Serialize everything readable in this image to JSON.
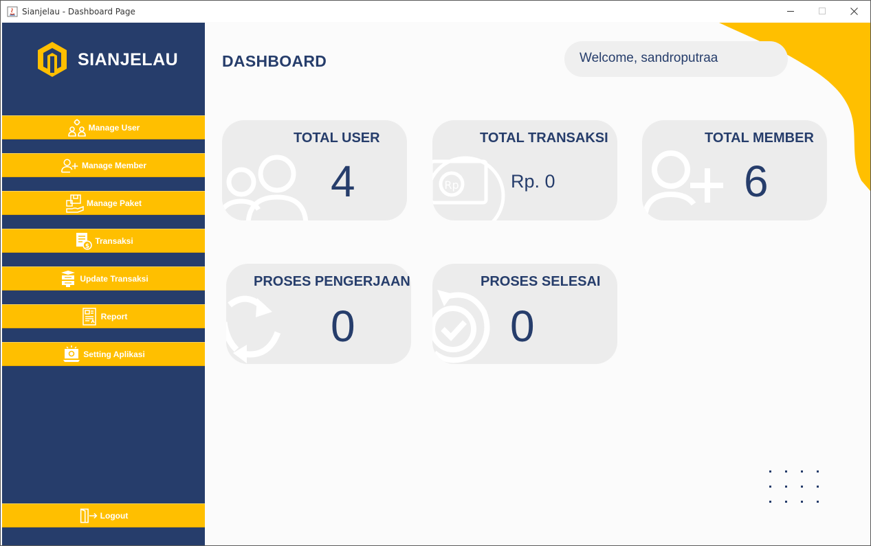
{
  "window": {
    "title": "Sianjelau - Dashboard Page",
    "controls": {
      "minimize": "minimize",
      "maximize": "maximize",
      "close": "close"
    }
  },
  "colors": {
    "navy": "#263d6b",
    "accent": "#ffbf00",
    "card": "#ececec",
    "background": "#fbfbfb"
  },
  "sidebar": {
    "brand": "SIANJELAU",
    "items": [
      {
        "label": "Manage User",
        "icon": "users-gear-icon"
      },
      {
        "label": "Manage Member",
        "icon": "add-user-icon"
      },
      {
        "label": "Manage Paket",
        "icon": "package-icon"
      },
      {
        "label": "Transaksi",
        "icon": "invoice-dollar-icon"
      },
      {
        "label": "Update Transaksi",
        "icon": "box-stack-icon"
      },
      {
        "label": "Report",
        "icon": "report-icon"
      },
      {
        "label": "Setting Aplikasi",
        "icon": "laptop-gear-icon"
      }
    ],
    "logout": {
      "label": "Logout",
      "icon": "logout-door-icon"
    }
  },
  "header": {
    "title": "DASHBOARD",
    "welcome": "Welcome, sandroputraa"
  },
  "cards": {
    "total_user": {
      "title": "TOTAL USER",
      "value": "4",
      "icon": "users-icon"
    },
    "total_transaksi": {
      "title": "TOTAL TRANSAKSI",
      "value": "Rp. 0",
      "icon": "money-icon"
    },
    "total_member": {
      "title": "TOTAL MEMBER",
      "value": "6",
      "icon": "add-user-icon"
    },
    "proses_pengerjaan": {
      "title": "PROSES PENGERJAAN",
      "value": "0",
      "icon": "refresh-icon"
    },
    "proses_selesai": {
      "title": "PROSES SELESAI",
      "value": "0",
      "icon": "check-cycle-icon"
    }
  }
}
